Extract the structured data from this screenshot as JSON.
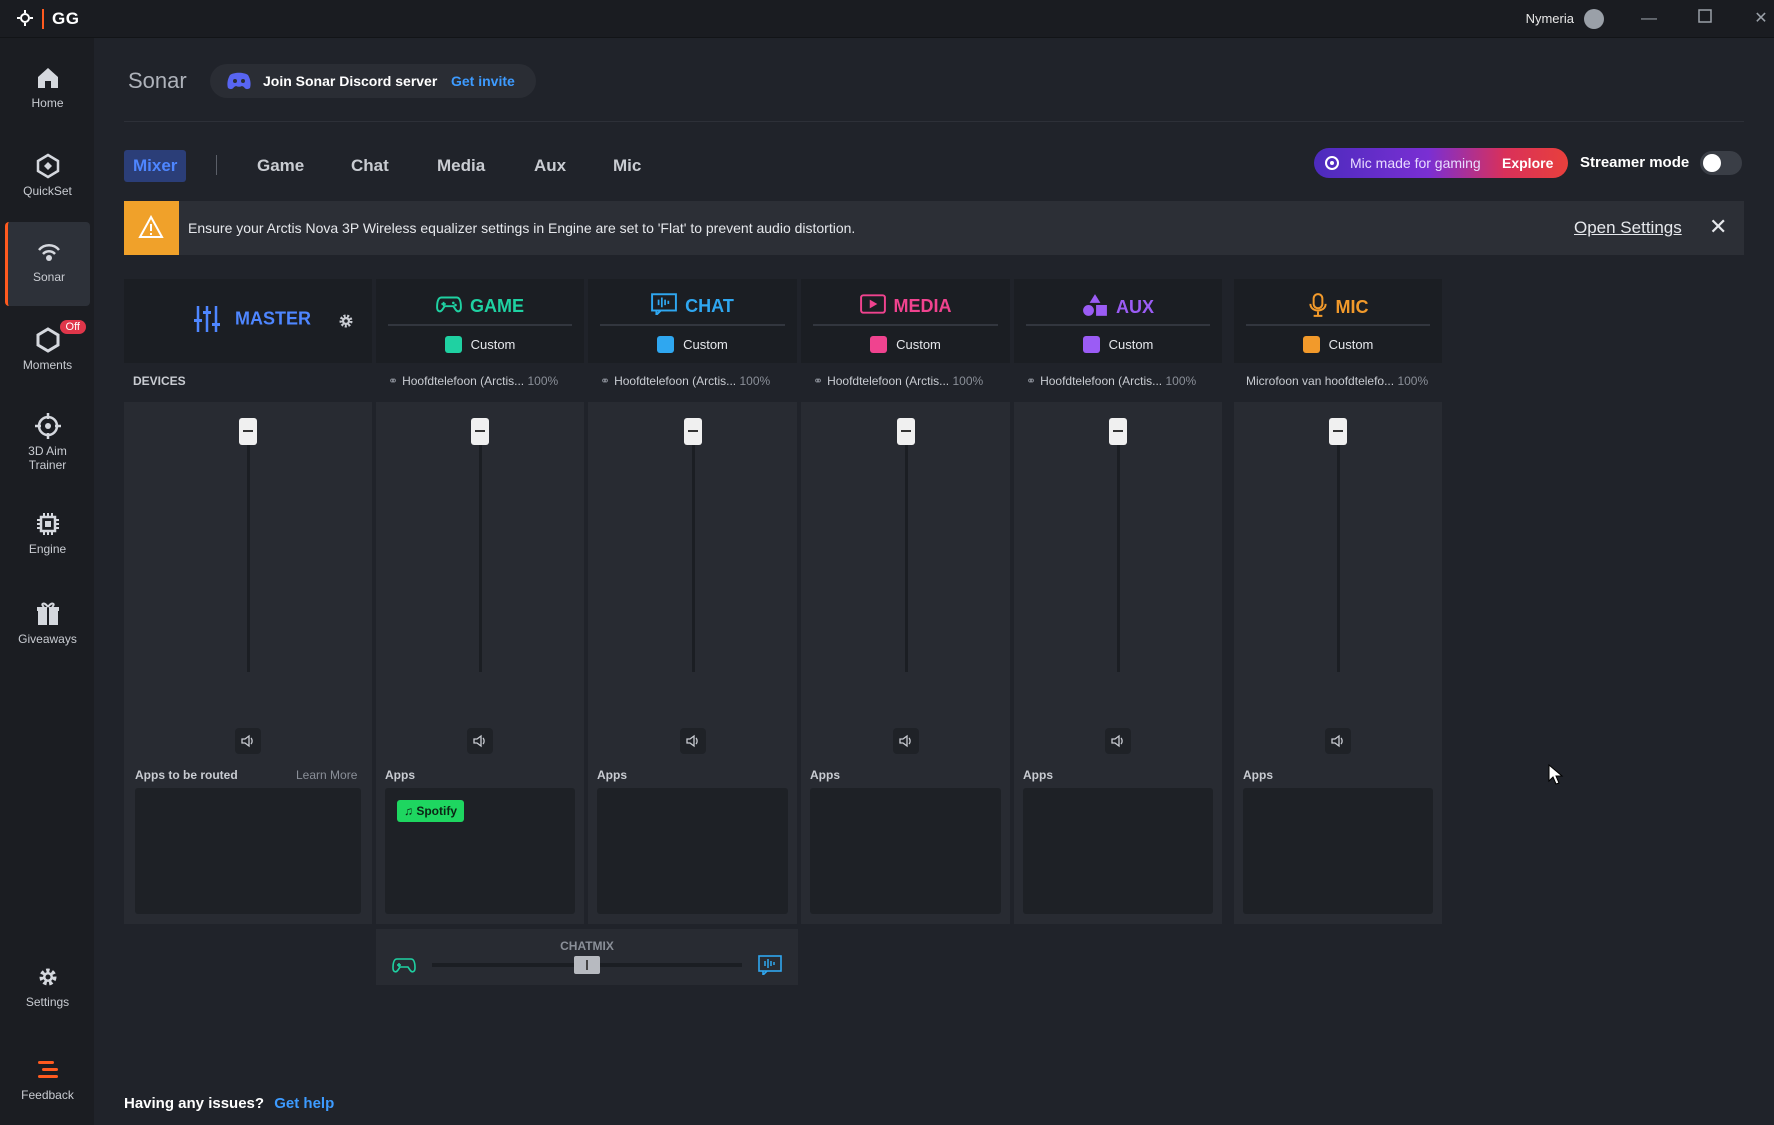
{
  "titlebar": {
    "brand": "GG",
    "username": "Nymeria"
  },
  "sidebar": {
    "items": [
      {
        "label": "Home"
      },
      {
        "label": "QuickSet"
      },
      {
        "label": "Sonar"
      },
      {
        "label": "Moments",
        "badge": "Off"
      },
      {
        "label": "3D Aim",
        "label2": "Trainer"
      },
      {
        "label": "Engine"
      },
      {
        "label": "Giveaways"
      },
      {
        "label": "Settings"
      },
      {
        "label": "Feedback"
      }
    ]
  },
  "header": {
    "title": "Sonar",
    "discord_text": "Join Sonar Discord server",
    "discord_link": "Get invite"
  },
  "tabs": [
    {
      "label": "Mixer"
    },
    {
      "label": "Game"
    },
    {
      "label": "Chat"
    },
    {
      "label": "Media"
    },
    {
      "label": "Aux"
    },
    {
      "label": "Mic"
    }
  ],
  "promo": {
    "text": "Mic made for gaming",
    "action": "Explore"
  },
  "streamer": {
    "label": "Streamer mode",
    "enabled": false
  },
  "banner": {
    "message": "Ensure your Arctis Nova 3P Wireless equalizer settings in Engine are set to 'Flat' to prevent audio distortion.",
    "action": "Open Settings"
  },
  "master": {
    "title": "MASTER",
    "devices_label": "DEVICES",
    "apps_label": "Apps to be routed",
    "learn_more": "Learn More"
  },
  "channels": [
    {
      "name": "GAME",
      "color": "#1fd1a2",
      "preset": "Custom",
      "device": "Hoofdtelefoon (Arctis...",
      "pct": "100%",
      "apps_label": "Apps",
      "apps": [
        "Spotify"
      ]
    },
    {
      "name": "CHAT",
      "color": "#2fa7f0",
      "preset": "Custom",
      "device": "Hoofdtelefoon (Arctis...",
      "pct": "100%",
      "apps_label": "Apps",
      "apps": []
    },
    {
      "name": "MEDIA",
      "color": "#f0438f",
      "preset": "Custom",
      "device": "Hoofdtelefoon (Arctis...",
      "pct": "100%",
      "apps_label": "Apps",
      "apps": []
    },
    {
      "name": "AUX",
      "color": "#9b5cf5",
      "preset": "Custom",
      "device": "Hoofdtelefoon (Arctis...",
      "pct": "100%",
      "apps_label": "Apps",
      "apps": []
    },
    {
      "name": "MIC",
      "color": "#f29a2b",
      "preset": "Custom",
      "device": "Microfoon van hoofdtelefo...",
      "pct": "100%",
      "apps_label": "Apps",
      "apps": []
    }
  ],
  "chatmix": {
    "label": "CHATMIX",
    "balance": 0.5
  },
  "footer": {
    "text": "Having any issues?",
    "link": "Get help"
  }
}
